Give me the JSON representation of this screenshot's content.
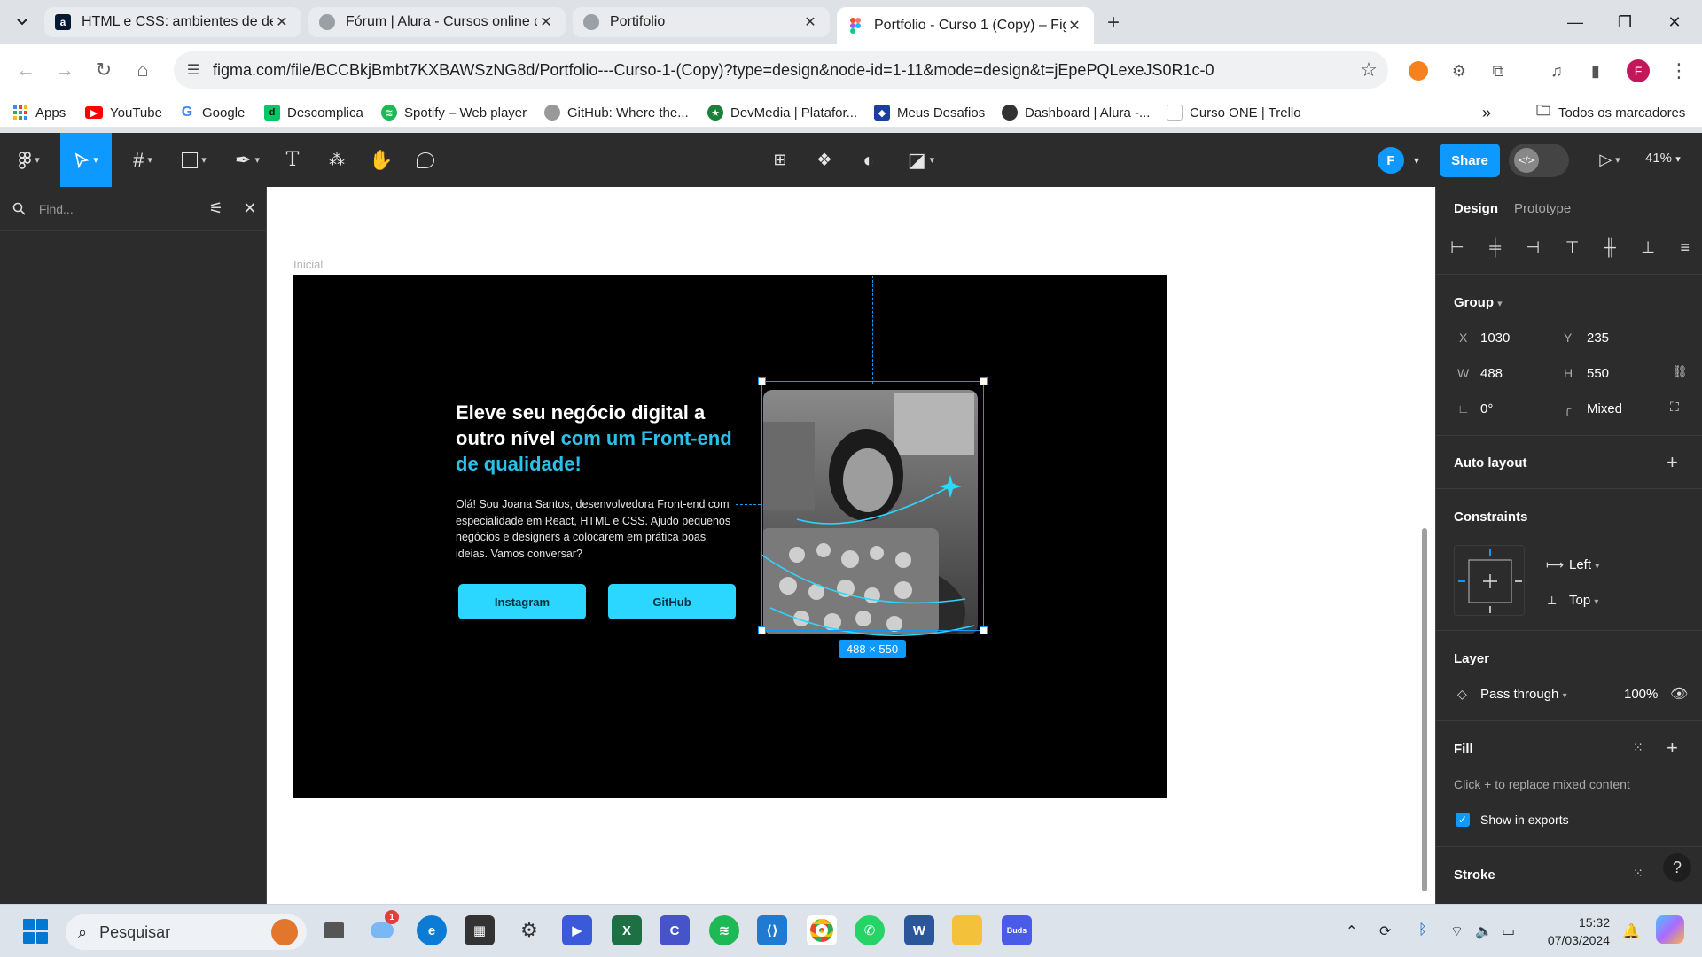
{
  "browser": {
    "tabs": [
      {
        "title": "HTML e CSS: ambientes de des",
        "favicon": "alura-a-icon",
        "active": false
      },
      {
        "title": "Fórum | Alura - Cursos online d",
        "favicon": "globe-icon",
        "active": false
      },
      {
        "title": "Portifolio",
        "favicon": "globe-icon",
        "active": false
      },
      {
        "title": "Portfolio - Curso 1 (Copy) – Fig",
        "favicon": "figma-icon",
        "active": true
      }
    ],
    "url": "figma.com/file/BCCBkjBmbt7KXBAWSzNG8d/Portfolio---Curso-1-(Copy)?type=design&node-id=1-11&mode=design&t=jEpePQLexeJS0R1c-0",
    "profile_initial": "F",
    "bookmarks": [
      {
        "label": "Apps",
        "icon": "apps-grid-icon"
      },
      {
        "label": "YouTube",
        "icon": "youtube-icon"
      },
      {
        "label": "Google",
        "icon": "google-icon"
      },
      {
        "label": "Descomplica",
        "icon": "descomplica-icon"
      },
      {
        "label": "Spotify – Web player",
        "icon": "spotify-icon"
      },
      {
        "label": "GitHub: Where the...",
        "icon": "github-icon"
      },
      {
        "label": "DevMedia | Platafor...",
        "icon": "devmedia-icon"
      },
      {
        "label": "Meus Desafios",
        "icon": "desafios-icon"
      },
      {
        "label": "Dashboard | Alura -...",
        "icon": "alura-icon"
      },
      {
        "label": "Curso ONE | Trello",
        "icon": "trello-icon"
      }
    ],
    "all_bookmarks_label": "Todos os marcadores"
  },
  "figma": {
    "avatar_initial": "F",
    "share_label": "Share",
    "zoom": "41%",
    "find_placeholder": "Find...",
    "frame_name": "Inicial",
    "design": {
      "headline_1": "Eleve seu negócio digital a outro nível ",
      "headline_2": "com um Front-end de qualidade!",
      "bio": "Olá! Sou Joana Santos, desenvolvedora Front-end com especialidade em React, HTML e CSS. Ajudo pequenos negócios e designers a colocarem em prática boas ideias. Vamos conversar?",
      "button_1": "Instagram",
      "button_2": "GitHub",
      "accent_color": "#2bc0ea"
    },
    "selection_size": "488 × 550",
    "panel": {
      "tab_design": "Design",
      "tab_prototype": "Prototype",
      "group_label": "Group",
      "x_label": "X",
      "x": "1030",
      "y_label": "Y",
      "y": "235",
      "w_label": "W",
      "w": "488",
      "h_label": "H",
      "h": "550",
      "rotation": "0°",
      "radius": "Mixed",
      "auto_layout": "Auto layout",
      "constraints": "Constraints",
      "constraint_h": "Left",
      "constraint_v": "Top",
      "layer": "Layer",
      "blend": "Pass through",
      "opacity": "100%",
      "fill": "Fill",
      "fill_hint": "Click + to replace mixed content",
      "show_exports": "Show in exports",
      "stroke": "Stroke"
    }
  },
  "taskbar": {
    "search_placeholder": "Pesquisar",
    "notification_count": "1",
    "time": "15:32",
    "date": "07/03/2024"
  }
}
